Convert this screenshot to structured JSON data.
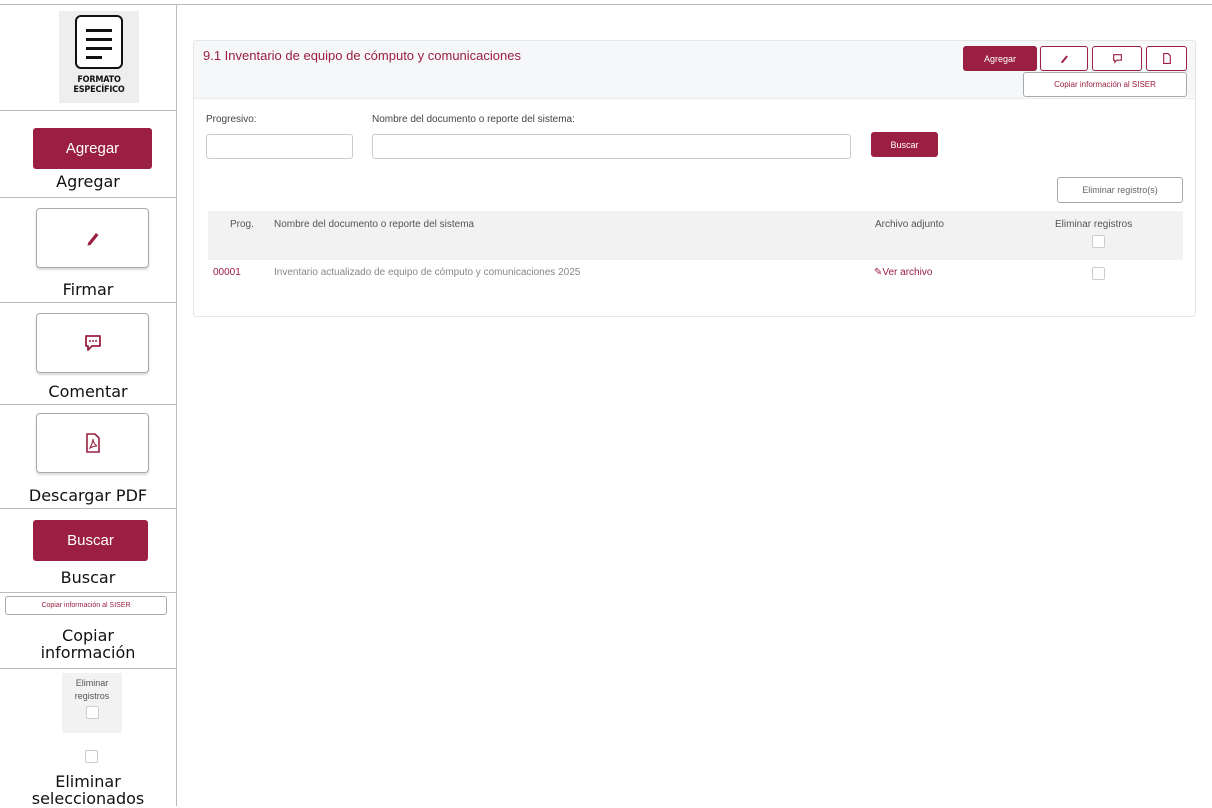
{
  "legend": {
    "formato": {
      "line1": "FORMATO",
      "line2": "ESPECÍFICO"
    },
    "agregar": {
      "button": "Agregar",
      "caption": "Agregar"
    },
    "firmar": {
      "caption": "Firmar",
      "icon": "pen-icon"
    },
    "comentar": {
      "caption": "Comentar",
      "icon": "comment-icon"
    },
    "pdf": {
      "caption": "Descargar PDF",
      "icon": "pdf-icon"
    },
    "buscar": {
      "button": "Buscar",
      "caption": "Buscar"
    },
    "copiar": {
      "button": "Copiar información al SISER",
      "caption_line1": "Copiar",
      "caption_line2": "información"
    },
    "eliminar": {
      "header_line1": "Eliminar",
      "header_line2": "registros",
      "caption_line1": "Eliminar",
      "caption_line2": "seleccionados"
    }
  },
  "panel": {
    "title": "9.1 Inventario de equipo de cómputo y comunicaciones",
    "toolbar": {
      "agregar": "Agregar",
      "copiar": "Copiar información al SISER"
    },
    "filters": {
      "progresivo_label": "Progresivo:",
      "progresivo_value": "",
      "nombre_label": "Nombre del documento o reporte del sistema:",
      "nombre_value": "",
      "buscar": "Buscar"
    },
    "eliminar_button": "Eliminar registro(s)",
    "table": {
      "headers": {
        "prog": "Prog.",
        "nombre": "Nombre del documento o reporte del sistema",
        "archivo": "Archivo adjunto",
        "eliminar": "Eliminar registros"
      },
      "rows": [
        {
          "prog": "00001",
          "nombre": "Inventario actualizado de equipo de cómputo y comunicaciones 2025",
          "archivo": "✎Ver archivo",
          "selected": false
        }
      ]
    }
  },
  "colors": {
    "brand": "#9a1f40",
    "border": "#bbbbbb",
    "header_bg": "#f6f7f9"
  }
}
